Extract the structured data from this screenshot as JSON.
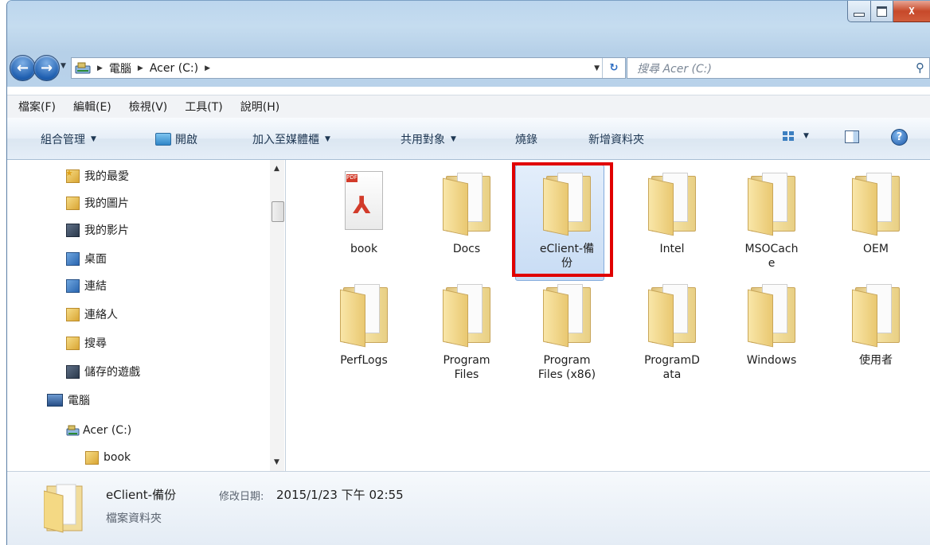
{
  "window": {
    "caption": {
      "minimize": "",
      "maximize": "",
      "close": "X"
    }
  },
  "address": {
    "crumbs": [
      "電腦",
      "Acer (C:)"
    ],
    "search_placeholder": "搜尋 Acer (C:)"
  },
  "menu": [
    "檔案(F)",
    "編輯(E)",
    "檢視(V)",
    "工具(T)",
    "說明(H)"
  ],
  "toolbar": {
    "organize": "組合管理",
    "open": "開啟",
    "add_to_library": "加入至媒體櫃",
    "share": "共用對象",
    "burn": "燒錄",
    "new_folder": "新增資料夾"
  },
  "nav": {
    "items": [
      {
        "label": "我的最愛"
      },
      {
        "label": "我的圖片"
      },
      {
        "label": "我的影片"
      },
      {
        "label": "桌面"
      },
      {
        "label": "連結"
      },
      {
        "label": "連絡人"
      },
      {
        "label": "搜尋"
      },
      {
        "label": "儲存的遊戲"
      },
      {
        "label": "電腦"
      },
      {
        "label": "Acer (C:)"
      },
      {
        "label": "book"
      }
    ]
  },
  "files": [
    {
      "name": "book",
      "type": "pdf"
    },
    {
      "name": "Docs",
      "type": "folder"
    },
    {
      "name": "eClient-備\n份",
      "type": "folder",
      "selected": true
    },
    {
      "name": "Intel",
      "type": "folder"
    },
    {
      "name": "MSOCach\ne",
      "type": "folder"
    },
    {
      "name": "OEM",
      "type": "folder"
    },
    {
      "name": "PerfLogs",
      "type": "folder"
    },
    {
      "name": "Program\nFiles",
      "type": "folder"
    },
    {
      "name": "Program\nFiles (x86)",
      "type": "folder"
    },
    {
      "name": "ProgramD\nata",
      "type": "folder"
    },
    {
      "name": "Windows",
      "type": "folder"
    },
    {
      "name": "使用者",
      "type": "folder"
    }
  ],
  "details": {
    "name": "eClient-備份",
    "modified_label": "修改日期:",
    "modified_value": "2015/1/23 下午 02:55",
    "type": "檔案資料夾"
  },
  "colors": {
    "selection_border": "#e00000",
    "accent": "#2b6cc2"
  }
}
